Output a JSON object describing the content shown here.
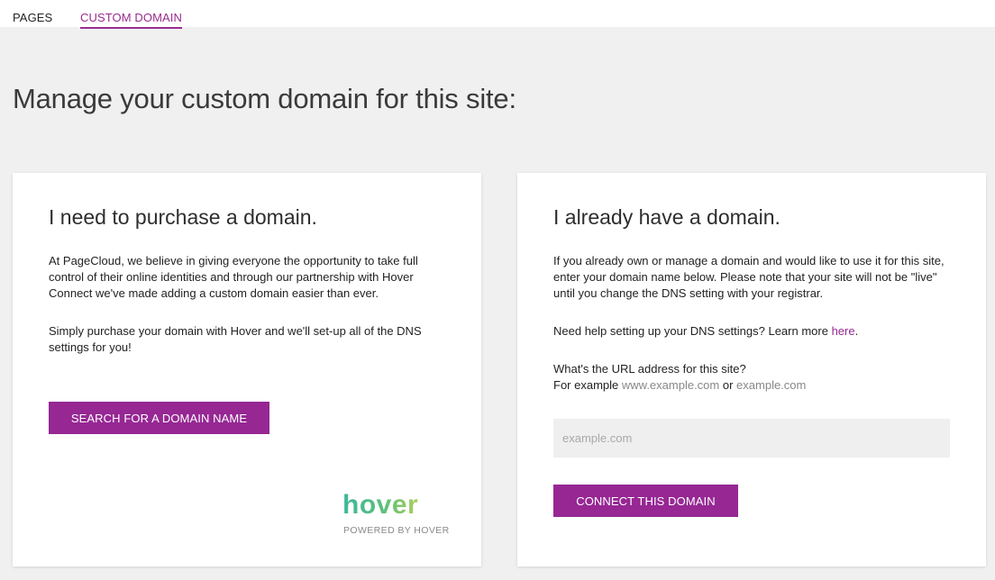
{
  "tabs": {
    "pages": "PAGES",
    "custom_domain": "CUSTOM DOMAIN"
  },
  "page_title": "Manage your custom domain for this site:",
  "purchase_card": {
    "heading": "I need to purchase a domain.",
    "paragraph1": "At PageCloud, we believe in giving everyone the opportunity to take full control of their online identities and through our partnership with Hover Connect we've made adding a custom domain easier than ever.",
    "paragraph2": "Simply purchase your domain with Hover and we'll set-up all of the DNS settings for you!",
    "search_button": "SEARCH FOR A DOMAIN NAME",
    "logo_text": "hover",
    "powered_by": "POWERED BY HOVER"
  },
  "existing_card": {
    "heading": "I already have a domain.",
    "paragraph1": "If you already own or manage a domain and would like to use it for this site, enter your domain name below. Please note that your site will not be \"live\" until you change the DNS setting with your registrar.",
    "help_text": "Need help setting up your DNS settings? Learn more ",
    "help_link": "here",
    "help_period": ".",
    "url_question": "What's the URL address for this site?",
    "example_prefix": "For example ",
    "example1": "www.example.com",
    "example_or": " or ",
    "example2": "example.com",
    "input_placeholder": "example.com",
    "input_value": "",
    "connect_button": "CONNECT THIS DOMAIN"
  },
  "colors": {
    "accent": "#962793",
    "background": "#f0f0f0",
    "card": "#ffffff"
  }
}
